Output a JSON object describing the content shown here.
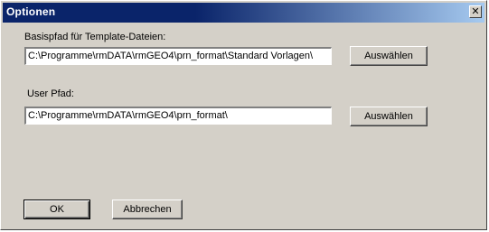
{
  "window": {
    "title": "Optionen",
    "close_glyph": "✕"
  },
  "template_path": {
    "label": "Basispfad für Template-Dateien:",
    "value": "C:\\Programme\\rmDATA\\rmGEO4\\prn_format\\Standard Vorlagen\\",
    "button_label": "Auswählen"
  },
  "user_path": {
    "label": "User Pfad:",
    "value": "C:\\Programme\\rmDATA\\rmGEO4\\prn_format\\",
    "button_label": "Auswählen"
  },
  "footer": {
    "ok_label": "OK",
    "cancel_label": "Abbrechen"
  }
}
